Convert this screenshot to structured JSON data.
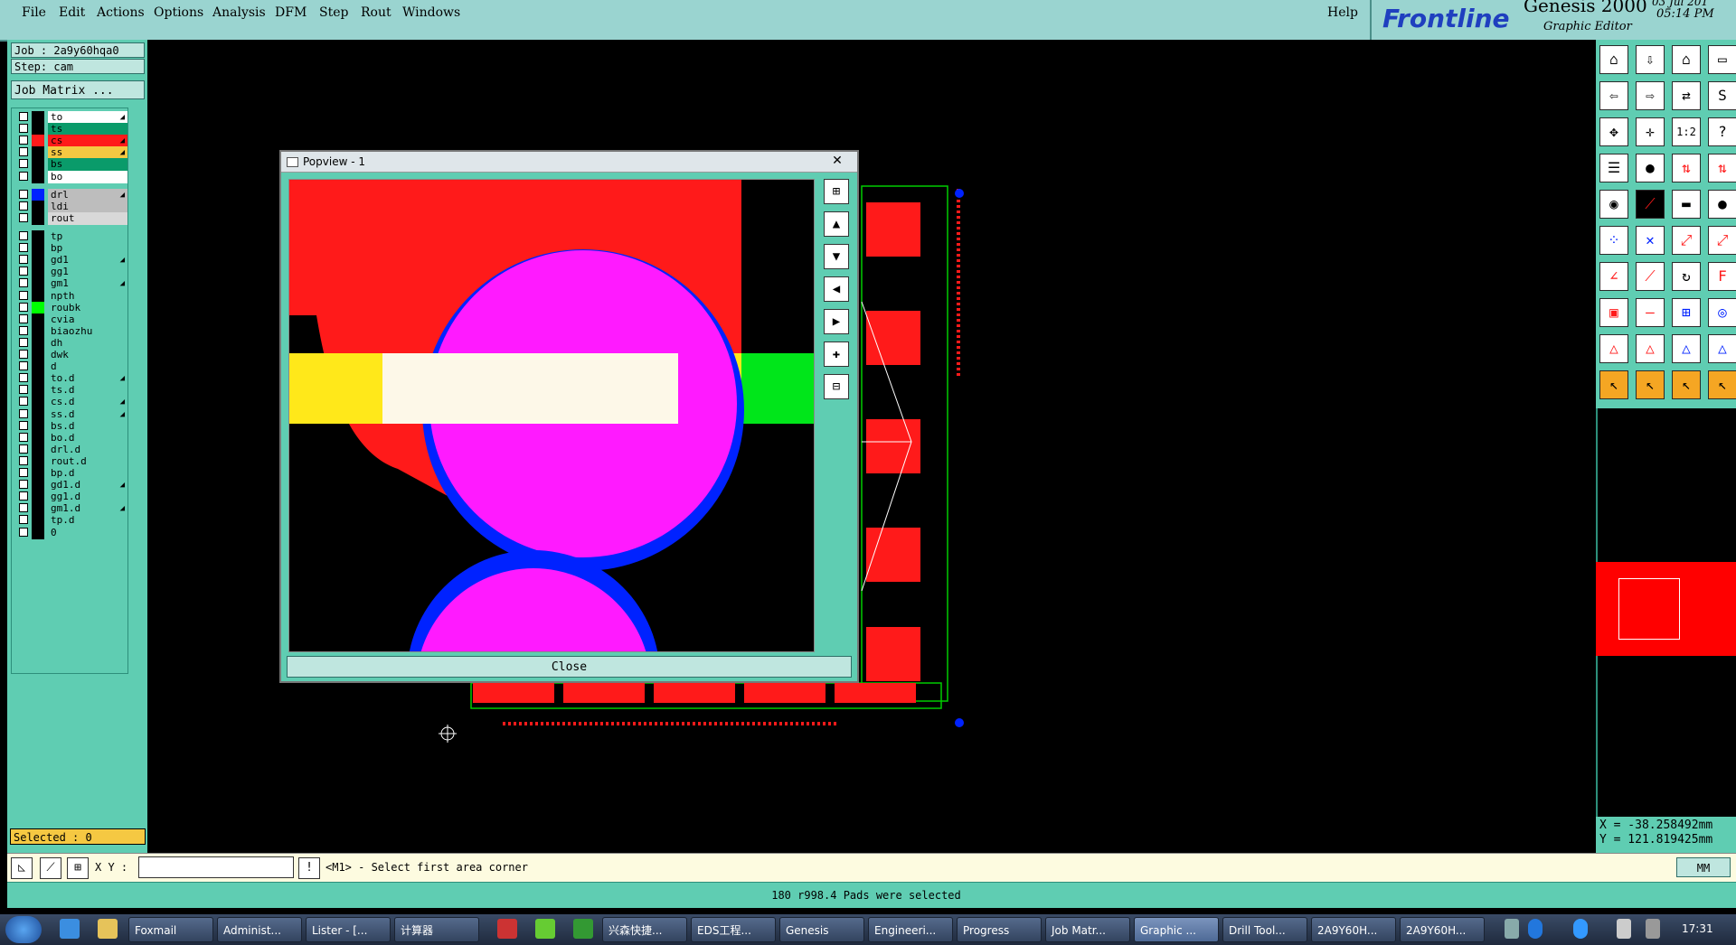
{
  "menubar": {
    "items": [
      "File",
      "Edit",
      "Actions",
      "Options",
      "Analysis",
      "DFM",
      "Step",
      "Rout",
      "Windows"
    ],
    "help": "Help"
  },
  "brand": {
    "logo": "Frontline",
    "product": "Genesis 2000",
    "subtitle": "Graphic Editor",
    "date_fragment": "03 Jul 201",
    "time": "05:14 PM"
  },
  "leftpanel": {
    "job": "Job : 2a9y60hqa0",
    "step": "Step: cam",
    "matrix_button": "Job Matrix ...",
    "selected": "Selected : 0"
  },
  "layers": [
    {
      "name": "to",
      "bg": "#ffffff",
      "sw": "#000000",
      "arrow": true
    },
    {
      "name": "ts",
      "bg": "#0a9b6a",
      "sw": "#000000",
      "arrow": false
    },
    {
      "name": "cs",
      "bg": "#ff1a1a",
      "sw": "#ff1a1a",
      "arrow": true
    },
    {
      "name": "ss",
      "bg": "#f5c842",
      "sw": "#000000",
      "arrow": true
    },
    {
      "name": "bs",
      "bg": "#0a9b6a",
      "sw": "#000000",
      "arrow": false
    },
    {
      "name": "bo",
      "bg": "#ffffff",
      "sw": "#000000",
      "arrow": false
    },
    {
      "name": "drl",
      "bg": "#bdbdbd",
      "sw": "#0022ff",
      "arrow": true
    },
    {
      "name": "ldi",
      "bg": "#bdbdbd",
      "sw": "#000000",
      "arrow": false
    },
    {
      "name": "rout",
      "bg": "#d8d8d8",
      "sw": "#000000",
      "arrow": false
    },
    {
      "name": "tp",
      "bg": "#5fcdb2",
      "sw": "#000000",
      "arrow": false
    },
    {
      "name": "bp",
      "bg": "#5fcdb2",
      "sw": "#000000",
      "arrow": false
    },
    {
      "name": "gd1",
      "bg": "#5fcdb2",
      "sw": "#000000",
      "arrow": true
    },
    {
      "name": "gg1",
      "bg": "#5fcdb2",
      "sw": "#000000",
      "arrow": false
    },
    {
      "name": "gm1",
      "bg": "#5fcdb2",
      "sw": "#000000",
      "arrow": true
    },
    {
      "name": "npth",
      "bg": "#5fcdb2",
      "sw": "#000000",
      "arrow": false
    },
    {
      "name": "roubk",
      "bg": "#5fcdb2",
      "sw": "#00ff00",
      "arrow": false
    },
    {
      "name": "cvia",
      "bg": "#5fcdb2",
      "sw": "#000000",
      "arrow": false
    },
    {
      "name": "biaozhu",
      "bg": "#5fcdb2",
      "sw": "#000000",
      "arrow": false
    },
    {
      "name": "dh",
      "bg": "#5fcdb2",
      "sw": "#000000",
      "arrow": false
    },
    {
      "name": "dwk",
      "bg": "#5fcdb2",
      "sw": "#000000",
      "arrow": false
    },
    {
      "name": "d",
      "bg": "#5fcdb2",
      "sw": "#000000",
      "arrow": false
    },
    {
      "name": "to.d",
      "bg": "#5fcdb2",
      "sw": "#000000",
      "arrow": true
    },
    {
      "name": "ts.d",
      "bg": "#5fcdb2",
      "sw": "#000000",
      "arrow": false
    },
    {
      "name": "cs.d",
      "bg": "#5fcdb2",
      "sw": "#000000",
      "arrow": true
    },
    {
      "name": "ss.d",
      "bg": "#5fcdb2",
      "sw": "#000000",
      "arrow": true
    },
    {
      "name": "bs.d",
      "bg": "#5fcdb2",
      "sw": "#000000",
      "arrow": false
    },
    {
      "name": "bo.d",
      "bg": "#5fcdb2",
      "sw": "#000000",
      "arrow": false
    },
    {
      "name": "drl.d",
      "bg": "#5fcdb2",
      "sw": "#000000",
      "arrow": false
    },
    {
      "name": "rout.d",
      "bg": "#5fcdb2",
      "sw": "#000000",
      "arrow": false
    },
    {
      "name": "bp.d",
      "bg": "#5fcdb2",
      "sw": "#000000",
      "arrow": false
    },
    {
      "name": "gd1.d",
      "bg": "#5fcdb2",
      "sw": "#000000",
      "arrow": true
    },
    {
      "name": "gg1.d",
      "bg": "#5fcdb2",
      "sw": "#000000",
      "arrow": false
    },
    {
      "name": "gm1.d",
      "bg": "#5fcdb2",
      "sw": "#000000",
      "arrow": true
    },
    {
      "name": "tp.d",
      "bg": "#5fcdb2",
      "sw": "#000000",
      "arrow": false
    },
    {
      "name": "0",
      "bg": "#5fcdb2",
      "sw": "#000000",
      "arrow": false
    }
  ],
  "popview": {
    "title": "Popview - 1",
    "close_x": "✕",
    "close_button": "Close"
  },
  "coords": {
    "x": "X = -38.258492mm",
    "y": "Y = 121.819425mm"
  },
  "cmdbar": {
    "xy_label": "X Y :",
    "xy_value": "",
    "prompt": "<M1> - Select first area corner",
    "units": "MM"
  },
  "status": "180 r998.4 Pads were selected",
  "taskbar": {
    "tasks": [
      "Foxmail",
      "Administ...",
      "Lister - [...",
      "计算器",
      "兴森快捷...",
      "EDS工程...",
      "Genesis",
      "Engineeri...",
      "Progress",
      "Job Matr...",
      "Graphic ...",
      "Drill Tool...",
      "2A9Y60H...",
      "2A9Y60H..."
    ],
    "clock": "17:31"
  }
}
